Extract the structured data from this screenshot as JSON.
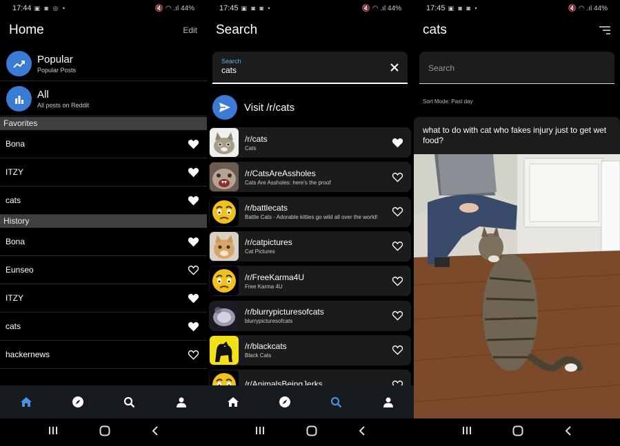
{
  "status_bars": [
    {
      "time": "17:44",
      "icons_left": "▣ ◙ ◎ •",
      "right": "🔇 ◠ .ıl 44%"
    },
    {
      "time": "17:45",
      "icons_left": "▣ ◙ ◙ •",
      "right": "🔇 ◠ .ıl 44%"
    },
    {
      "time": "17:45",
      "icons_left": "▣ ◙ ◙ •",
      "right": "🔇 ◠ .ıl 44%"
    }
  ],
  "home": {
    "title": "Home",
    "edit_label": "Edit",
    "feeds": [
      {
        "title": "Popular",
        "subtitle": "Popular Posts",
        "icon": "trending-icon"
      },
      {
        "title": "All",
        "subtitle": "All posts on Reddit",
        "icon": "bar-chart-icon"
      }
    ],
    "favorites_label": "Favorites",
    "favorites": [
      {
        "name": "Bona",
        "favorited": true
      },
      {
        "name": "ITZY",
        "favorited": true
      },
      {
        "name": "cats",
        "favorited": true
      }
    ],
    "history_label": "History",
    "history": [
      {
        "name": "Bona",
        "favorited": true
      },
      {
        "name": "Eunseo",
        "favorited": false
      },
      {
        "name": "ITZY",
        "favorited": true
      },
      {
        "name": "cats",
        "favorited": true
      },
      {
        "name": "hackernews",
        "favorited": false
      }
    ]
  },
  "search": {
    "title": "Search",
    "field_label": "Search",
    "field_value": "cats",
    "visit_label": "Visit /r/cats",
    "results": [
      {
        "name": "/r/cats",
        "desc": "Cats",
        "favorited": true,
        "thumb": "cat"
      },
      {
        "name": "/r/CatsAreAssholes",
        "desc": "Cats Are Assholes: here's the proof",
        "favorited": false,
        "thumb": "angry-cat"
      },
      {
        "name": "/r/battlecats",
        "desc": "Battle Cats - Adorable kitties go wild all over the world!",
        "favorited": false,
        "thumb": "emoji"
      },
      {
        "name": "/r/catpictures",
        "desc": "Cat Pictures",
        "favorited": false,
        "thumb": "ginger-cat"
      },
      {
        "name": "/r/FreeKarma4U",
        "desc": "Free Karma 4U",
        "favorited": false,
        "thumb": "emoji"
      },
      {
        "name": "/r/blurrypicturesofcats",
        "desc": "blurrypicturesofcats",
        "favorited": false,
        "thumb": "blurry-cat"
      },
      {
        "name": "/r/blackcats",
        "desc": "Black Cats",
        "favorited": false,
        "thumb": "black-cat"
      },
      {
        "name": "/r/AnimalsBeingJerks",
        "desc": "",
        "favorited": false,
        "thumb": "emoji"
      }
    ]
  },
  "subreddit": {
    "title": "cats",
    "search_placeholder": "Search",
    "sort_mode": "Sort Mode: Past day",
    "post_title": "what to do with cat who fakes injury just to get wet food?"
  },
  "bottom_nav": [
    "home-icon",
    "explore-icon",
    "search-icon",
    "profile-icon"
  ],
  "colors": {
    "accent": "#3a7bd5",
    "active_nav": "#4a90e2",
    "nav_bg": "#16191e",
    "section_bg": "#3f3f3f"
  }
}
